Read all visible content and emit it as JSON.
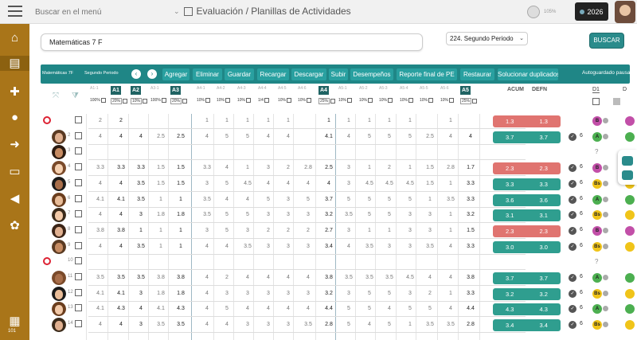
{
  "app": {
    "menu_search_placeholder": "Buscar en el menú",
    "breadcrumb": "Evaluación / Planillas de Actividades",
    "zoom_label": "105%",
    "year": "2026"
  },
  "sidebar": {
    "items": [
      "home-icon",
      "report-icon",
      "add-user-icon",
      "users-icon",
      "exit-icon",
      "card-icon",
      "megaphone-icon",
      "gear-icon"
    ],
    "bottom_label": "101"
  },
  "filters": {
    "subject": "Matemáticas 7 F",
    "period": "224. Segundo Periodo",
    "search_button": "BUSCAR"
  },
  "toolbar": {
    "subject": "Matemáticas 7F",
    "period": "Segundo Periodo",
    "buttons": [
      "Agregar",
      "Eliminar",
      "Guardar",
      "Recargar",
      "Descargar",
      "Subir",
      "Desempeños",
      "Reporte final de PE",
      "Restaurar",
      "Solucionar duplicados"
    ],
    "status": "Autoguardado pausado"
  },
  "grid": {
    "columns": [
      {
        "label": "A1-1",
        "bold": false
      },
      {
        "label": "A1",
        "bold": true
      },
      {
        "label": "A2",
        "bold": true
      },
      {
        "label": "A3-1",
        "bold": false
      },
      {
        "label": "A3",
        "bold": true
      },
      {
        "label": "A4-1",
        "bold": false
      },
      {
        "label": "A4-2",
        "bold": false
      },
      {
        "label": "A4-3",
        "bold": false
      },
      {
        "label": "A4-4",
        "bold": false
      },
      {
        "label": "A4-5",
        "bold": false
      },
      {
        "label": "A4-6",
        "bold": false
      },
      {
        "label": "A4",
        "bold": true
      },
      {
        "label": "A5-1",
        "bold": false
      },
      {
        "label": "A5-2",
        "bold": false
      },
      {
        "label": "A5-3",
        "bold": false
      },
      {
        "label": "A5-4",
        "bold": false
      },
      {
        "label": "A5-5",
        "bold": false
      },
      {
        "label": "A5-6",
        "bold": false
      },
      {
        "label": "A5",
        "bold": true
      }
    ],
    "pct_row": [
      "100%",
      "20%",
      "10%",
      "100%",
      "20%",
      "10%",
      "10%",
      "10%",
      "1/4",
      "10%",
      "10%",
      "25%",
      "10%",
      "10%",
      "10%",
      "10%",
      "10%",
      "10%",
      "25%"
    ],
    "acum_header": "ACUM",
    "defn_header": "DEFN",
    "d1_header": "D1",
    "d_header": "D",
    "rows": [
      {
        "num": "",
        "banned": true,
        "grades": [
          "2",
          "2",
          "",
          "",
          "",
          "1",
          "1",
          "1",
          "1",
          "1",
          "",
          "1",
          "1",
          "1",
          "1",
          "1",
          "",
          "1",
          ""
        ],
        "acum": "1.3",
        "defn": "1.3",
        "status": "red",
        "check": false,
        "six": "",
        "letter": "B",
        "letter_color": "#c24fa8",
        "q": false
      },
      {
        "num": "2",
        "banned": false,
        "grades": [
          "4",
          "4",
          "4",
          "2.5",
          "2.5",
          "4",
          "5",
          "5",
          "4",
          "4",
          "",
          "4.1",
          "4",
          "5",
          "5",
          "5",
          "2.5",
          "4",
          "4"
        ],
        "acum": "3.7",
        "defn": "3.7",
        "status": "green",
        "check": true,
        "six": "6",
        "letter": "A",
        "letter_color": "#4caf50",
        "q": false
      },
      {
        "num": "3",
        "banned": false,
        "grades": [
          "",
          "",
          "",
          "",
          "",
          "",
          "",
          "",
          "",
          "",
          "",
          "",
          "",
          "",
          "",
          "",
          "",
          "",
          ""
        ],
        "acum": "",
        "defn": "",
        "status": "none",
        "check": false,
        "six": "",
        "letter": "",
        "letter_color": "",
        "q": true
      },
      {
        "num": "4",
        "banned": false,
        "grades": [
          "3.3",
          "3.3",
          "3.3",
          "1.5",
          "1.5",
          "3.3",
          "4",
          "1",
          "3",
          "2",
          "2.8",
          "2.5",
          "3",
          "1",
          "2",
          "1",
          "1.5",
          "2.8",
          "1.7"
        ],
        "acum": "2.3",
        "defn": "2.3",
        "status": "red",
        "check": true,
        "six": "6",
        "letter": "B",
        "letter_color": "#c24fa8",
        "q": false
      },
      {
        "num": "5",
        "banned": false,
        "grades": [
          "4",
          "4",
          "3.5",
          "1.5",
          "1.5",
          "3",
          "5",
          "4.5",
          "4",
          "4",
          "4",
          "4",
          "3",
          "4.5",
          "4.5",
          "4.5",
          "1.5",
          "1",
          "3.3"
        ],
        "acum": "3.3",
        "defn": "3.3",
        "status": "green",
        "check": true,
        "six": "6",
        "letter": "Bs",
        "letter_color": "#f0c419",
        "q": false
      },
      {
        "num": "6",
        "banned": false,
        "grades": [
          "4.1",
          "4.1",
          "3.5",
          "1",
          "1",
          "3.5",
          "4",
          "4",
          "5",
          "3",
          "5",
          "3.7",
          "5",
          "5",
          "5",
          "5",
          "1",
          "3.5",
          "3.3"
        ],
        "acum": "3.6",
        "defn": "3.6",
        "status": "green",
        "check": true,
        "six": "6",
        "letter": "A",
        "letter_color": "#4caf50",
        "q": false
      },
      {
        "num": "7",
        "banned": false,
        "grades": [
          "4",
          "4",
          "3",
          "1.8",
          "1.8",
          "3.5",
          "5",
          "5",
          "3",
          "3",
          "3",
          "3.2",
          "3.5",
          "5",
          "5",
          "3",
          "3",
          "1",
          "3.2"
        ],
        "acum": "3.1",
        "defn": "3.1",
        "status": "green",
        "check": true,
        "six": "6",
        "letter": "Bs",
        "letter_color": "#f0c419",
        "q": false
      },
      {
        "num": "8",
        "banned": false,
        "grades": [
          "3.8",
          "3.8",
          "1",
          "1",
          "1",
          "3",
          "5",
          "3",
          "2",
          "2",
          "2",
          "2.7",
          "3",
          "1",
          "1",
          "3",
          "3",
          "1",
          "1.5"
        ],
        "acum": "2.3",
        "defn": "2.3",
        "status": "red",
        "check": true,
        "six": "6",
        "letter": "B",
        "letter_color": "#c24fa8",
        "q": false
      },
      {
        "num": "9",
        "banned": false,
        "grades": [
          "4",
          "4",
          "3.5",
          "1",
          "1",
          "4",
          "4",
          "3.5",
          "3",
          "3",
          "3",
          "3.4",
          "4",
          "3.5",
          "3",
          "3",
          "3.5",
          "4",
          "3.3"
        ],
        "acum": "3.0",
        "defn": "3.0",
        "status": "green",
        "check": true,
        "six": "6",
        "letter": "Bs",
        "letter_color": "#f0c419",
        "q": false
      },
      {
        "num": "10",
        "banned": true,
        "grades": [
          "",
          "",
          "",
          "",
          "",
          "",
          "",
          "",
          "",
          "",
          "",
          "",
          "",
          "",
          "",
          "",
          "",
          "",
          ""
        ],
        "acum": "",
        "defn": "",
        "status": "none",
        "check": false,
        "six": "",
        "letter": "",
        "letter_color": "",
        "q": true
      },
      {
        "num": "11",
        "banned": false,
        "grades": [
          "3.5",
          "3.5",
          "3.5",
          "3.8",
          "3.8",
          "4",
          "2",
          "4",
          "4",
          "4",
          "4",
          "3.8",
          "3.5",
          "3.5",
          "3.5",
          "4.5",
          "4",
          "4",
          "3.8"
        ],
        "acum": "3.7",
        "defn": "3.7",
        "status": "green",
        "check": true,
        "six": "6",
        "letter": "A",
        "letter_color": "#4caf50",
        "q": false
      },
      {
        "num": "12",
        "banned": false,
        "grades": [
          "4.1",
          "4.1",
          "3",
          "1.8",
          "1.8",
          "4",
          "3",
          "3",
          "3",
          "3",
          "3",
          "3.2",
          "3",
          "5",
          "5",
          "3",
          "2",
          "1",
          "3.3"
        ],
        "acum": "3.2",
        "defn": "3.2",
        "status": "green",
        "check": true,
        "six": "6",
        "letter": "Bs",
        "letter_color": "#f0c419",
        "q": false
      },
      {
        "num": "13",
        "banned": false,
        "grades": [
          "4.1",
          "4.3",
          "4",
          "4.1",
          "4.3",
          "4",
          "5",
          "4",
          "4",
          "4",
          "4",
          "4.4",
          "5",
          "5",
          "4",
          "5",
          "5",
          "4",
          "4.4"
        ],
        "acum": "4.3",
        "defn": "4.3",
        "status": "green",
        "check": true,
        "six": "6",
        "letter": "A",
        "letter_color": "#4caf50",
        "q": false
      },
      {
        "num": "14",
        "banned": false,
        "grades": [
          "4",
          "4",
          "3",
          "3.5",
          "3.5",
          "4",
          "4",
          "3",
          "3",
          "3",
          "3.5",
          "2.8",
          "5",
          "4",
          "5",
          "1",
          "3.5",
          "3.5",
          "2.8"
        ],
        "acum": "3.4",
        "defn": "3.4",
        "status": "green",
        "check": true,
        "six": "6",
        "letter": "Bs",
        "letter_color": "#f0c419",
        "q": false
      }
    ]
  },
  "colors": {
    "sidebar": "#a97519",
    "toolbar": "#1f8686",
    "green_status": "#2f9e8f",
    "red_status": "#e07470"
  }
}
